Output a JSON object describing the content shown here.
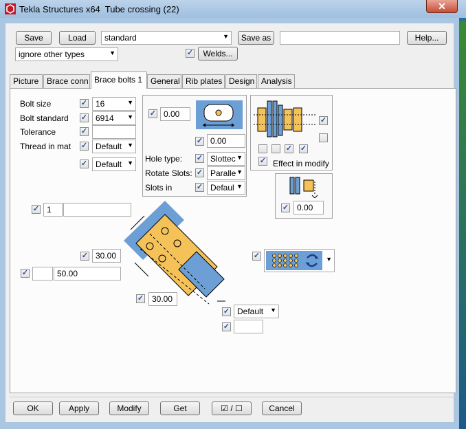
{
  "window": {
    "title": "Tekla Structures x64  Tube crossing (22)",
    "close_glyph": "✕",
    "app_icon": "tekla-logo-icon"
  },
  "toolbar": {
    "save_label": "Save",
    "load_label": "Load",
    "preset_value": "standard",
    "save_as_label": "Save as",
    "save_as_value": "",
    "help_label": "Help...",
    "filter_value": "ignore other types",
    "welds_label": "Welds..."
  },
  "tabs": [
    {
      "label": "Picture"
    },
    {
      "label": "Brace conn"
    },
    {
      "label": "Brace bolts 1"
    },
    {
      "label": "General"
    },
    {
      "label": "Rib plates"
    },
    {
      "label": "Design"
    },
    {
      "label": "Analysis"
    }
  ],
  "bolt_props": {
    "bolt_size_label": "Bolt size",
    "bolt_size_value": "16",
    "bolt_standard_label": "Bolt standard",
    "bolt_standard_value": "6914",
    "tolerance_label": "Tolerance",
    "tolerance_value": "",
    "thread_label": "Thread in mat",
    "thread_value": "Default",
    "extra_value": "Default"
  },
  "hole": {
    "offset_value": "0.00",
    "slot_value": "0.00",
    "hole_type_label": "Hole type:",
    "hole_type_value": "Slottec",
    "rotate_label": "Rotate Slots:",
    "rotate_value": "Paralle",
    "slots_in_label": "Slots in",
    "slots_in_value": "Defaul"
  },
  "effect": {
    "label": "Effect in modify",
    "gap_value": "0.00"
  },
  "layout": {
    "count_value": "1",
    "count_extra": "",
    "dim_a": "30.00",
    "dim_b_left": "",
    "dim_b": "50.00",
    "dim_c": "30.00",
    "bottom_combo": "Default",
    "bottom_field": ""
  },
  "footer": {
    "ok_label": "OK",
    "apply_label": "Apply",
    "modify_label": "Modify",
    "get_label": "Get",
    "toggle_label": "☑ / ☐",
    "cancel_label": "Cancel"
  },
  "colors": {
    "plate_blue": "#6b9fd6",
    "plate_yellow": "#f5c25a",
    "check_blue": "#2b4fa8"
  }
}
